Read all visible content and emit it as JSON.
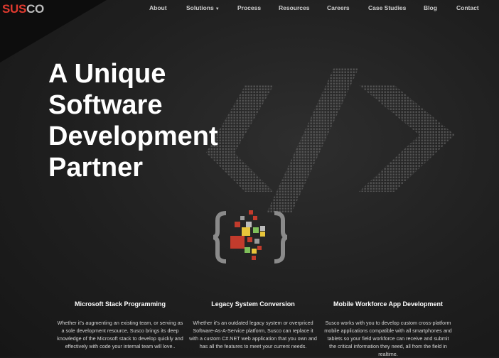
{
  "brand": {
    "part1": "SUS",
    "part2": "CO"
  },
  "nav": {
    "about": "About",
    "solutions": "Solutions",
    "process": "Process",
    "resources": "Resources",
    "careers": "Careers",
    "case_studies": "Case Studies",
    "blog": "Blog",
    "contact": "Contact"
  },
  "hero": {
    "line1": "A Unique",
    "line2": "Software",
    "line3": "Development",
    "line4": "Partner"
  },
  "features": [
    {
      "title": "Microsoft Stack Programming",
      "text": "Whether it's augmenting an existing team, or serving as a sole development resource, Susco brings its deep knowledge of the Microsoft stack to develop quickly and effectively with code your internal team will love.."
    },
    {
      "title": "Legacy System Conversion",
      "text": "Whether it's an outdated legacy system or overpriced Software-As-A-Service platform, Susco can replace it with a custom C#.NET web application that you own and has all the features to meet your current needs."
    },
    {
      "title": "Mobile Workforce App Development",
      "text": "Susco works with you to develop custom cross-platform mobile applications compatible with all smartphones and tablets so your field workforce can receive and submit the critical information they need, all from the field in realtime."
    }
  ],
  "colors": {
    "brand_red": "#e03a2f",
    "brand_gray": "#bdbdbd"
  },
  "icons": [
    "code-brackets-background-icon",
    "pixel-braces-logo-icon"
  ]
}
